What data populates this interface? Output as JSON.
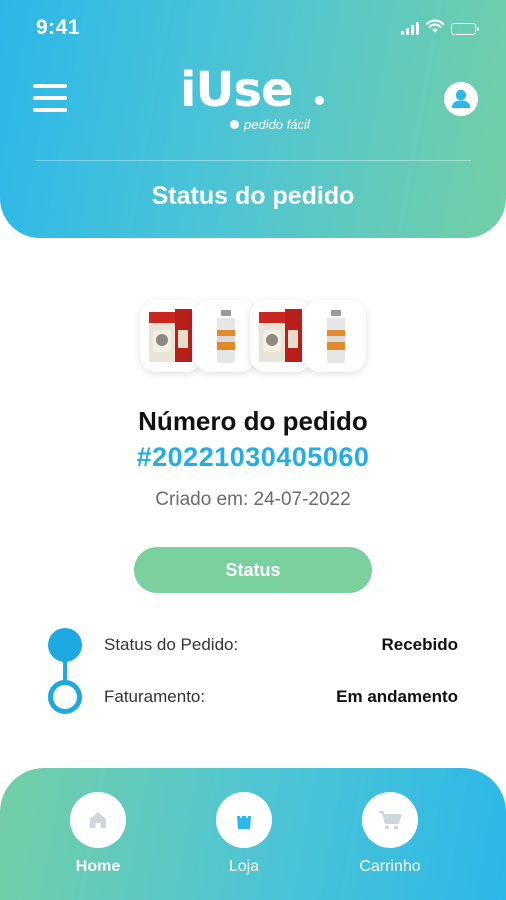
{
  "status_bar": {
    "time": "9:41"
  },
  "header": {
    "logo_text": "iUse",
    "logo_tagline": "pedido fácil",
    "title": "Status do pedido",
    "menu_icon": "hamburger-menu-icon",
    "profile_icon": "user-profile-icon"
  },
  "order": {
    "label": "Número do pedido",
    "number": "#20221030405060",
    "created": "Criado em: 24-07-2022",
    "products": [
      "product-box-image",
      "product-bottle-image",
      "product-box-image",
      "product-bottle-image"
    ]
  },
  "status_button": {
    "label": "Status"
  },
  "timeline": [
    {
      "label": "Status do Pedido:",
      "value": "Recebido",
      "state": "complete"
    },
    {
      "label": "Faturamento:",
      "value": "Em andamento",
      "state": "in-progress"
    }
  ],
  "bottom_nav": {
    "items": [
      {
        "label": "Home",
        "icon": "home-icon",
        "active": true
      },
      {
        "label": "Loja",
        "icon": "shopping-bag-icon",
        "active": false
      },
      {
        "label": "Carrinho",
        "icon": "cart-icon",
        "active": false
      }
    ]
  },
  "colors": {
    "accent_blue": "#22aee6",
    "accent_green": "#7bd0a0",
    "nav_icon_gray": "#cfd6dc"
  }
}
